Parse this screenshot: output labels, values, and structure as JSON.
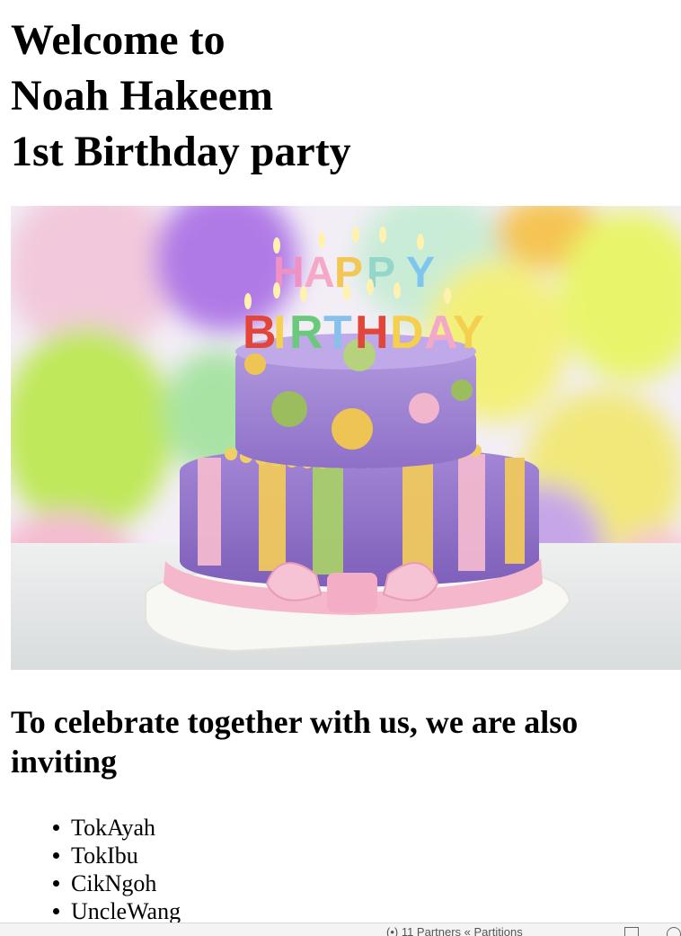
{
  "heading": {
    "line1": "Welcome to",
    "line2": "Noah Hakeem",
    "line3": "1st Birthday party"
  },
  "image": {
    "subject": "birthday-cake-photo",
    "candle_letters": "HAPPY BIRTHDAY"
  },
  "invite_heading": "To celebrate together with us, we are also inviting",
  "guests": [
    "TokAyah",
    "TokIbu",
    "CikNgoh",
    "UncleWang"
  ],
  "status_bar": {
    "text": "(•) 11 Partners « Partitions"
  }
}
